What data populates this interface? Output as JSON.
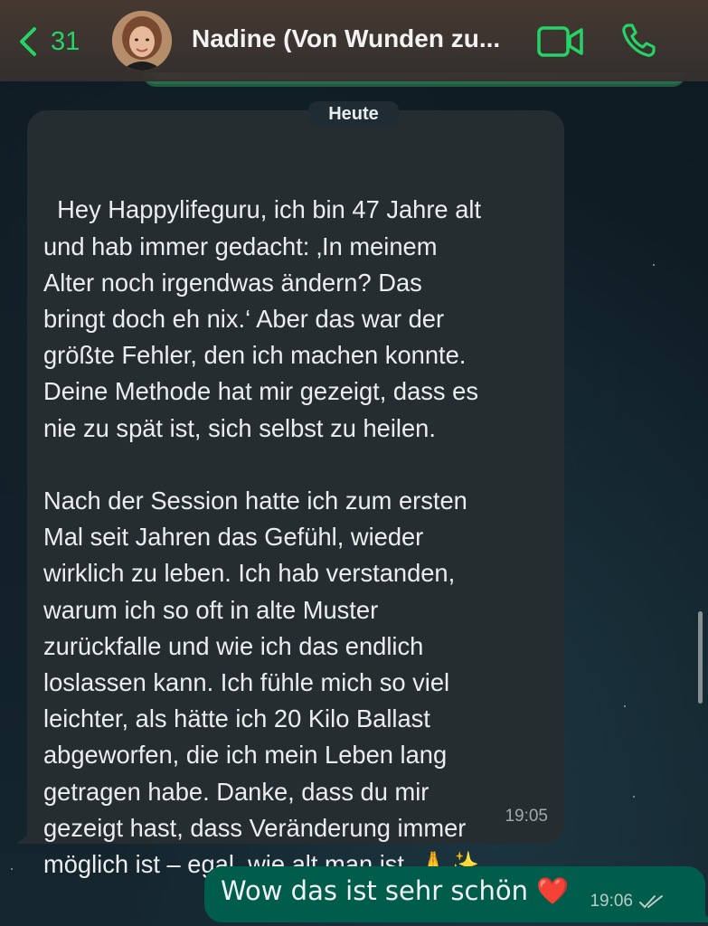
{
  "header": {
    "back_count": "31",
    "contact_name": "Nadine (Von Wunden zu...",
    "accent_color": "#25d366"
  },
  "date_separator": "Heute",
  "messages": [
    {
      "direction": "incoming",
      "text": "Hey Happylifeguru, ich bin 47 Jahre alt\nund hab immer gedacht: ‚In meinem\nAlter noch irgendwas ändern? Das\nbringt doch eh nix.‘ Aber das war der\ngrößte Fehler, den ich machen konnte.\nDeine Methode hat mir gezeigt, dass es\nnie zu spät ist, sich selbst zu heilen.\n\nNach der Session hatte ich zum ersten\nMal seit Jahren das Gefühl, wieder\nwirklich zu leben. Ich hab verstanden,\nwarum ich so oft in alte Muster\nzurückfalle und wie ich das endlich\nloslassen kann. Ich fühle mich so viel\nleichter, als hätte ich 20 Kilo Ballast\nabgeworfen, die ich mein Leben lang\ngetragen habe. Danke, dass du mir\ngezeigt hast, dass Veränderung immer\nmöglich ist – egal, wie alt man ist. 🙏✨",
      "time": "19:05"
    },
    {
      "direction": "outgoing",
      "text": "Wow das ist sehr schön ❤️",
      "time": "19:06",
      "status_icon": "read-double-check-icon"
    }
  ]
}
